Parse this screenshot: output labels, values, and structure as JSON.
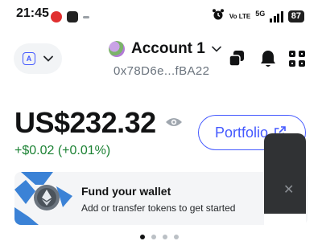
{
  "status_bar": {
    "time": "21:45",
    "network": "Vo LTE",
    "signal_type": "5G",
    "battery": "87"
  },
  "header": {
    "account_name": "Account 1",
    "account_address": "0x78D6e...fBA22"
  },
  "balance": {
    "amount": "US$232.32",
    "change": "+$0.02 (+0.01%)"
  },
  "portfolio_button": {
    "label": "Portfolio"
  },
  "promo_card": {
    "title": "Fund your wallet",
    "subtitle": "Add or transfer tokens to get started"
  },
  "pagination": {
    "count": 4,
    "active_index": 0
  },
  "colors": {
    "accent": "#4459ff",
    "positive": "#1c8234",
    "text": "#121314",
    "muted": "#6a737d"
  }
}
